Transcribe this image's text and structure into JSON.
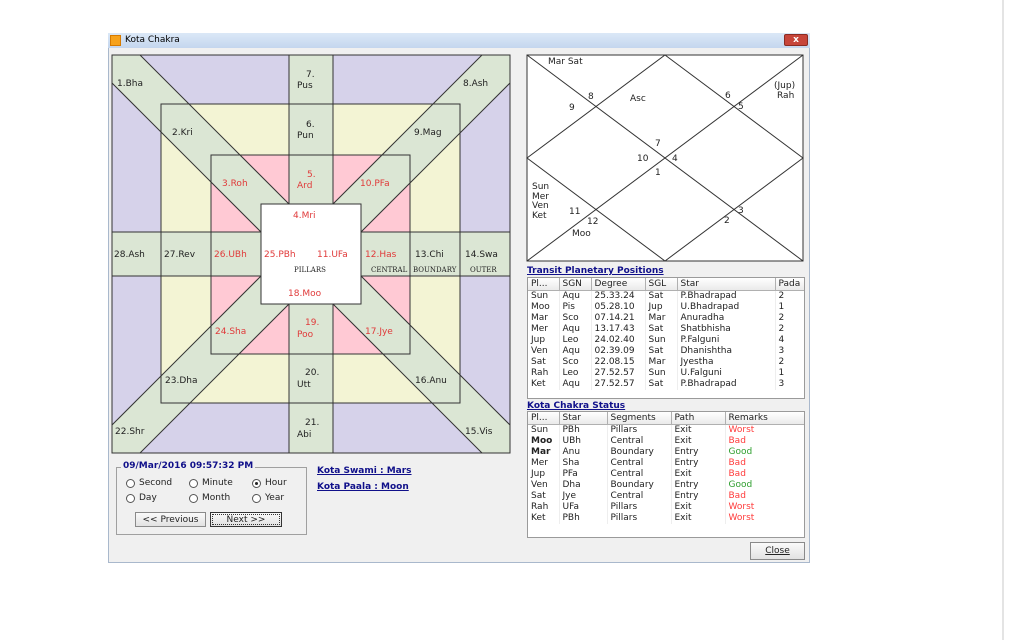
{
  "window": {
    "title": "Kota Chakra",
    "close_glyph": "x"
  },
  "kota_chart": {
    "colors": {
      "outer": "#d6d2ea",
      "boundary": "#f3f4d4",
      "central": "#ffc9d4",
      "band": "#dbe6d4",
      "pillars": "#ffffff",
      "highlight_text": "#e03a3a"
    },
    "stars": {
      "s1": "1.Bha",
      "s2": "2.Kri",
      "s3": "3.Roh",
      "s4": "4.Mri",
      "s5a": "5.",
      "s5b": "Ard",
      "s6a": "6.",
      "s6b": "Pun",
      "s7a": "7.",
      "s7b": "Pus",
      "s8": "8.Ash",
      "s9": "9.Mag",
      "s10": "10.PFa",
      "s11": "11.UFa",
      "s12": "12.Has",
      "s13": "13.Chi",
      "s14": "14.Swa",
      "s15": "15.Vis",
      "s16": "16.Anu",
      "s17": "17.Jye",
      "s18": "18.Moo",
      "s19a": "19.",
      "s19b": "Poo",
      "s20a": "20.",
      "s20b": "Utt",
      "s21a": "21.",
      "s21b": "Abi",
      "s22": "22.Shr",
      "s23": "23.Dha",
      "s24": "24.Sha",
      "s25": "25.PBh",
      "s26": "26.UBh",
      "s27": "27.Rev",
      "s28": "28.Ash"
    },
    "segments": {
      "pillars": "PILLARS",
      "central": "CENTRAL",
      "boundary": "BOUNDARY",
      "outer": "OUTER"
    }
  },
  "rasi_chart": {
    "h8_planets": "Mar Sat",
    "h9": "9",
    "h8": "8",
    "asc": "Asc",
    "h6": "6",
    "h5": "5",
    "h5_planets_1": "(Jup)",
    "h5_planets_2": "Rah",
    "h7": "7",
    "h10": "10",
    "h4": "4",
    "h1": "1",
    "h11_p1": "Sun",
    "h11_p2": "Mer",
    "h11_p3": "Ven",
    "h11_p4": "Ket",
    "h11": "11",
    "h12": "12",
    "h12_planets": "Moo",
    "h3": "3",
    "h2": "2"
  },
  "transit": {
    "title": "Transit Planetary Positions",
    "columns": [
      "Pl...",
      "SGN",
      "Degree",
      "SGL",
      "Star",
      "Pada"
    ],
    "rows": [
      [
        "Sun",
        "Aqu",
        "25.33.24",
        "Sat",
        "P.Bhadrapad",
        "2"
      ],
      [
        "Moo",
        "Pis",
        "05.28.10",
        "Jup",
        "U.Bhadrapad",
        "1"
      ],
      [
        "Mar",
        "Sco",
        "07.14.21",
        "Mar",
        "Anuradha",
        "2"
      ],
      [
        "Mer",
        "Aqu",
        "13.17.43",
        "Sat",
        "Shatbhisha",
        "2"
      ],
      [
        "Jup",
        "Leo",
        "24.02.40",
        "Sun",
        "P.Falguni",
        "4"
      ],
      [
        "Ven",
        "Aqu",
        "02.39.09",
        "Sat",
        "Dhanishtha",
        "3"
      ],
      [
        "Sat",
        "Sco",
        "22.08.15",
        "Mar",
        "Jyestha",
        "2"
      ],
      [
        "Rah",
        "Leo",
        "27.52.57",
        "Sun",
        "U.Falguni",
        "1"
      ],
      [
        "Ket",
        "Aqu",
        "27.52.57",
        "Sat",
        "P.Bhadrapad",
        "3"
      ]
    ]
  },
  "status": {
    "title": "Kota Chakra Status",
    "columns": [
      "Pl...",
      "Star",
      "Segments",
      "Path",
      "Remarks"
    ],
    "bold_planets": [
      "Moo",
      "Mar"
    ],
    "remark_colors": {
      "Worst": "#ff3b3b",
      "Bad": "#ff3b3b",
      "Good": "#2e9e2e"
    },
    "rows": [
      [
        "Sun",
        "PBh",
        "Pillars",
        "Exit",
        "Worst"
      ],
      [
        "Moo",
        "UBh",
        "Central",
        "Exit",
        "Bad"
      ],
      [
        "Mar",
        "Anu",
        "Boundary",
        "Entry",
        "Good"
      ],
      [
        "Mer",
        "Sha",
        "Central",
        "Entry",
        "Bad"
      ],
      [
        "Jup",
        "PFa",
        "Central",
        "Exit",
        "Bad"
      ],
      [
        "Ven",
        "Dha",
        "Boundary",
        "Entry",
        "Good"
      ],
      [
        "Sat",
        "Jye",
        "Central",
        "Entry",
        "Bad"
      ],
      [
        "Rah",
        "UFa",
        "Pillars",
        "Exit",
        "Worst"
      ],
      [
        "Ket",
        "PBh",
        "Pillars",
        "Exit",
        "Worst"
      ]
    ]
  },
  "time_control": {
    "datetime": "09/Mar/2016 09:57:32 PM",
    "options": [
      "Second",
      "Minute",
      "Hour",
      "Day",
      "Month",
      "Year"
    ],
    "selected": "Hour",
    "previous_label": "<<  Previous",
    "next_label": "Next >>"
  },
  "kota": {
    "swami": "Kota Swami : Mars",
    "paala": "Kota Paala : Moon"
  },
  "close_label": "Close"
}
